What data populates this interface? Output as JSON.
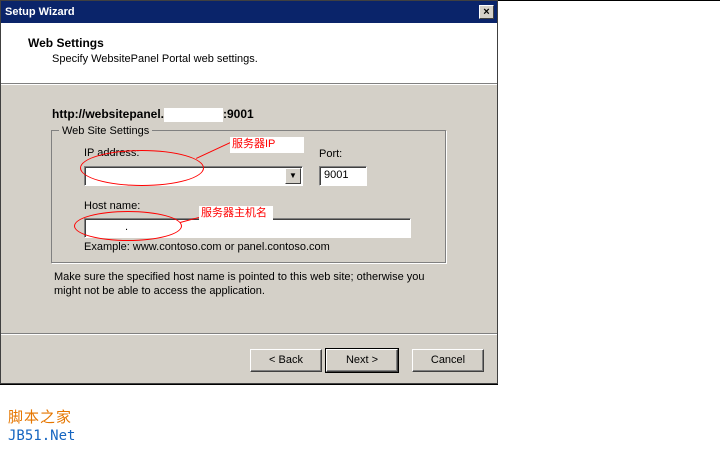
{
  "window": {
    "title": "Setup Wizard",
    "close_glyph": "×"
  },
  "header": {
    "title": "Web Settings",
    "subtitle": "Specify WebsitePanel Portal web settings."
  },
  "url": {
    "prefix": "http://websitepanel.",
    "suffix": ":9001"
  },
  "group": {
    "legend": "Web Site Settings",
    "ip_label": "IP address:",
    "port_label": "Port:",
    "port_value": "9001",
    "host_label": "Host name:",
    "host_value": ".",
    "example": "Example: www.contoso.com or panel.contoso.com"
  },
  "note": "Make sure the specified host name is pointed to this web site; otherwise you might not be able to access the application.",
  "annotations": {
    "ip": "服务器IP",
    "host": "服务器主机名"
  },
  "buttons": {
    "back": "< Back",
    "next": "Next >",
    "cancel": "Cancel"
  },
  "watermark": {
    "line1": "脚本之家",
    "line2": "JB51.Net"
  },
  "colors": {
    "titlebar": "#0a246a",
    "annotation": "#ff0000",
    "dialog_bg": "#d4d0c8"
  }
}
